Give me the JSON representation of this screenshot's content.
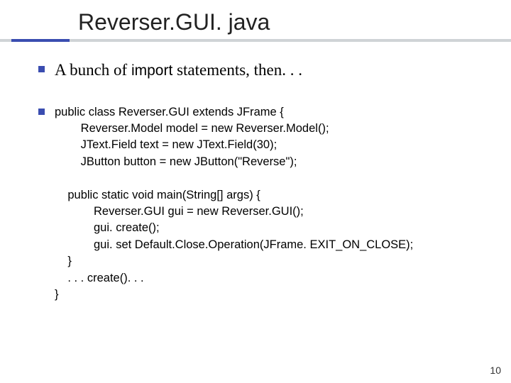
{
  "title": "Reverser.GUI. java",
  "bullet1_pre": "A bunch of ",
  "bullet1_import": "import",
  "bullet1_post": " statements, then. . .",
  "code": "public class Reverser.GUI extends JFrame {\n        Reverser.Model model = new Reverser.Model();\n        JText.Field text = new JText.Field(30);\n        JButton button = new JButton(\"Reverse\");\n\n    public static void main(String[] args) {\n            Reverser.GUI gui = new Reverser.GUI();\n            gui. create();\n            gui. set Default.Close.Operation(JFrame. EXIT_ON_CLOSE);\n    }\n    . . . create(). . .\n}",
  "page_number": "10"
}
